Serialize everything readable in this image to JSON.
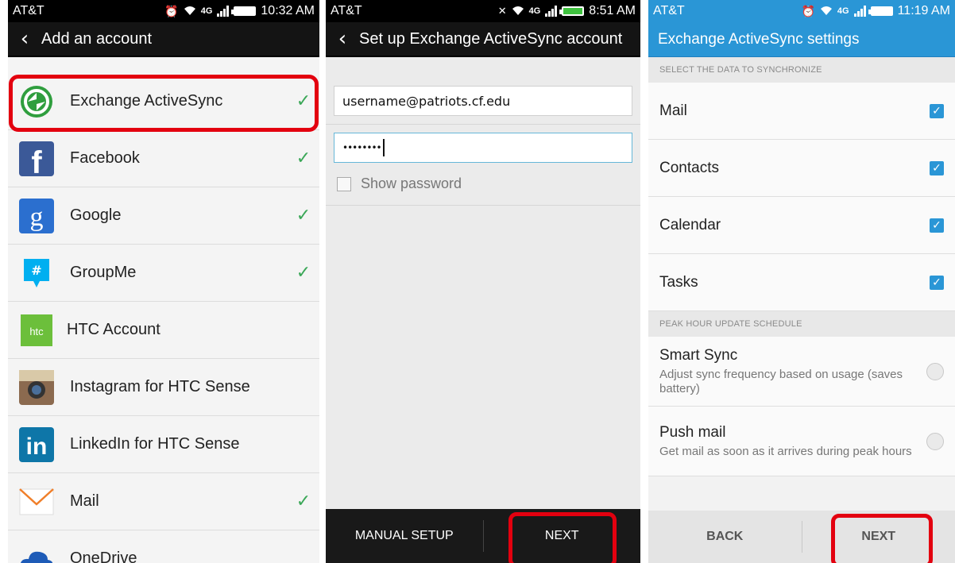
{
  "screen1": {
    "carrier": "AT&T",
    "time": "10:32 AM",
    "title": "Add an account",
    "accounts": [
      {
        "label": "Exchange ActiveSync",
        "icon": "exchange-activesync-icon",
        "checked": true
      },
      {
        "label": "Facebook",
        "icon": "facebook-icon",
        "checked": true
      },
      {
        "label": "Google",
        "icon": "google-icon",
        "checked": true
      },
      {
        "label": "GroupMe",
        "icon": "groupme-icon",
        "checked": true
      },
      {
        "label": "HTC Account",
        "icon": "htc-icon",
        "checked": false
      },
      {
        "label": "Instagram for HTC Sense",
        "icon": "instagram-icon",
        "checked": false
      },
      {
        "label": "LinkedIn for HTC Sense",
        "icon": "linkedin-icon",
        "checked": false
      },
      {
        "label": "Mail",
        "icon": "mail-icon",
        "checked": true
      },
      {
        "label": "OneDrive",
        "icon": "onedrive-icon",
        "checked": false
      }
    ]
  },
  "screen2": {
    "carrier": "AT&T",
    "time": "8:51 AM",
    "title": "Set up Exchange ActiveSync account",
    "email_value": "username@patriots.cf.edu",
    "password_mask": "••••••••",
    "show_password_label": "Show password",
    "manual_setup_label": "MANUAL SETUP",
    "next_label": "NEXT"
  },
  "screen3": {
    "carrier": "AT&T",
    "time": "11:19 AM",
    "title": "Exchange ActiveSync settings",
    "sync_section_label": "SELECT THE DATA TO SYNCHRONIZE",
    "sync_items": [
      {
        "label": "Mail",
        "checked": true
      },
      {
        "label": "Contacts",
        "checked": true
      },
      {
        "label": "Calendar",
        "checked": true
      },
      {
        "label": "Tasks",
        "checked": true
      }
    ],
    "peak_section_label": "PEAK HOUR UPDATE SCHEDULE",
    "schedule_options": [
      {
        "title": "Smart Sync",
        "desc": "Adjust sync frequency based on usage (saves battery)"
      },
      {
        "title": "Push mail",
        "desc": "Get mail as soon as it arrives during peak hours"
      }
    ],
    "back_label": "BACK",
    "next_label": "NEXT"
  },
  "colors": {
    "highlight": "#e3000f",
    "check_green": "#3aa757",
    "header_blue": "#2a96d6"
  }
}
